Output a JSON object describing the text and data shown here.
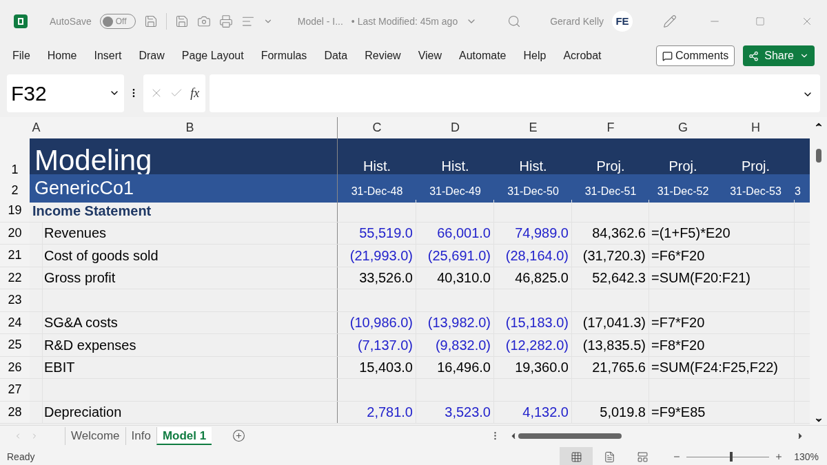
{
  "title_bar": {
    "autosave_label": "AutoSave",
    "autosave": {
      "on": false,
      "label": "Off"
    },
    "document_title": "Model - I...",
    "last_modified": "• Last Modified: 45m ago",
    "user_name": "Gerard Kelly",
    "avatar_initials": "FE"
  },
  "ribbon_tabs": [
    "File",
    "Home",
    "Insert",
    "Draw",
    "Page Layout",
    "Formulas",
    "Data",
    "Review",
    "View",
    "Automate",
    "Help",
    "Acrobat"
  ],
  "ribbon_buttons": {
    "comments": "Comments",
    "share": "Share"
  },
  "formula_bar": {
    "name_box": "F32",
    "fx": "fx"
  },
  "columns": [
    "A",
    "B",
    "C",
    "D",
    "E",
    "F",
    "G",
    "H"
  ],
  "header_rows": [
    {
      "number": "1",
      "label": "Modeling",
      "cells": [
        "Hist.",
        "Hist.",
        "Hist.",
        "Proj.",
        "Proj.",
        "Proj."
      ]
    },
    {
      "number": "2",
      "label": "GenericCo1",
      "cells": [
        "31-Dec-48",
        "31-Dec-49",
        "31-Dec-50",
        "31-Dec-51",
        "31-Dec-52",
        "31-Dec-53"
      ],
      "overflow": "3"
    }
  ],
  "rows": [
    {
      "number": "19",
      "kind": "section",
      "label": "Income Statement",
      "cells": []
    },
    {
      "number": "20",
      "kind": "line",
      "label": "Revenues",
      "cells": [
        {
          "text": "55,519.0",
          "kind": "input"
        },
        {
          "text": "66,001.0",
          "kind": "input"
        },
        {
          "text": "74,989.0",
          "kind": "input"
        },
        {
          "text": "84,362.6",
          "kind": "calc"
        },
        {
          "text": "=(1+F5)*E20",
          "kind": "formula"
        }
      ]
    },
    {
      "number": "21",
      "kind": "line",
      "label": "Cost of goods sold",
      "cells": [
        {
          "text": "(21,993.0)",
          "kind": "input"
        },
        {
          "text": "(25,691.0)",
          "kind": "input"
        },
        {
          "text": "(28,164.0)",
          "kind": "input"
        },
        {
          "text": "(31,720.3)",
          "kind": "calc"
        },
        {
          "text": "=F6*F20",
          "kind": "formula"
        }
      ]
    },
    {
      "number": "22",
      "kind": "line",
      "label": "Gross profit",
      "cells": [
        {
          "text": "33,526.0",
          "kind": "calc"
        },
        {
          "text": "40,310.0",
          "kind": "calc"
        },
        {
          "text": "46,825.0",
          "kind": "calc"
        },
        {
          "text": "52,642.3",
          "kind": "calc"
        },
        {
          "text": "=SUM(F20:F21)",
          "kind": "formula"
        }
      ]
    },
    {
      "number": "23",
      "kind": "line",
      "label": "",
      "cells": []
    },
    {
      "number": "24",
      "kind": "line",
      "label": "SG&A costs",
      "cells": [
        {
          "text": "(10,986.0)",
          "kind": "input"
        },
        {
          "text": "(13,982.0)",
          "kind": "input"
        },
        {
          "text": "(15,183.0)",
          "kind": "input"
        },
        {
          "text": "(17,041.3)",
          "kind": "calc"
        },
        {
          "text": "=F7*F20",
          "kind": "formula"
        }
      ]
    },
    {
      "number": "25",
      "kind": "line",
      "label": "R&D expenses",
      "cells": [
        {
          "text": "(7,137.0)",
          "kind": "input"
        },
        {
          "text": "(9,832.0)",
          "kind": "input"
        },
        {
          "text": "(12,282.0)",
          "kind": "input"
        },
        {
          "text": "(13,835.5)",
          "kind": "calc"
        },
        {
          "text": "=F8*F20",
          "kind": "formula"
        }
      ]
    },
    {
      "number": "26",
      "kind": "line",
      "label": "EBIT",
      "cells": [
        {
          "text": "15,403.0",
          "kind": "calc"
        },
        {
          "text": "16,496.0",
          "kind": "calc"
        },
        {
          "text": "19,360.0",
          "kind": "calc"
        },
        {
          "text": "21,765.6",
          "kind": "calc"
        },
        {
          "text": "=SUM(F24:F25,F22)",
          "kind": "formula"
        }
      ]
    },
    {
      "number": "27",
      "kind": "line",
      "label": "",
      "cells": []
    },
    {
      "number": "28",
      "kind": "line",
      "label": "Depreciation",
      "cells": [
        {
          "text": "2,781.0",
          "kind": "input"
        },
        {
          "text": "3,523.0",
          "kind": "input"
        },
        {
          "text": "4,132.0",
          "kind": "input"
        },
        {
          "text": "5,019.8",
          "kind": "calc"
        },
        {
          "text": "=F9*E85",
          "kind": "formula"
        }
      ]
    }
  ],
  "sheet_tabs": [
    {
      "label": "Welcome",
      "selected": false
    },
    {
      "label": "Info",
      "selected": false
    },
    {
      "label": "Model 1",
      "selected": true
    }
  ],
  "status_bar": {
    "status": "Ready",
    "views": [
      {
        "kind": "normal",
        "selected": true
      },
      {
        "kind": "page-layout",
        "selected": false
      },
      {
        "kind": "page-break",
        "selected": false
      }
    ],
    "zoom": {
      "level": 0.54,
      "label": "130%"
    }
  }
}
